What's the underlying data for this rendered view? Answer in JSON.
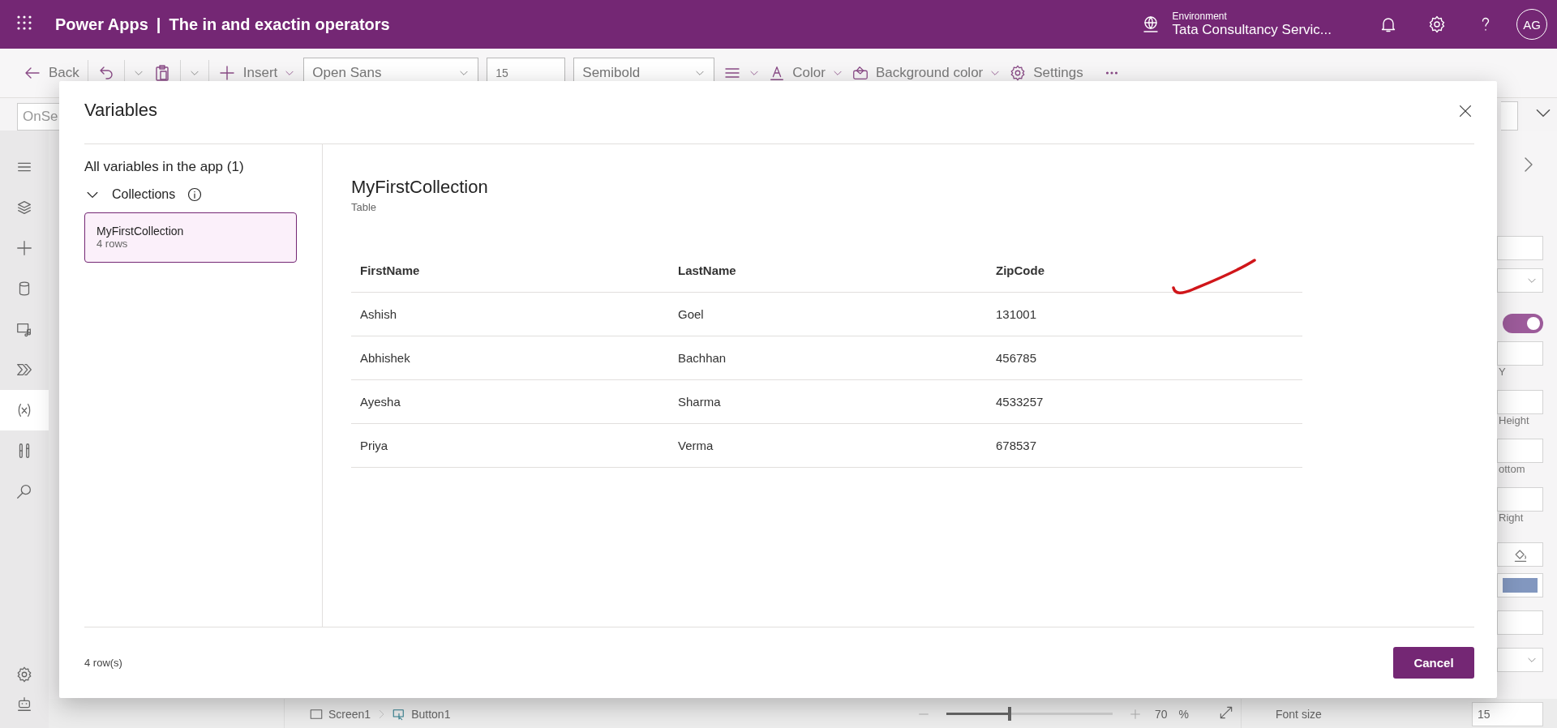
{
  "header": {
    "app_name": "Power Apps",
    "separator": "|",
    "document_title": "The in and exactin operators",
    "environment_label": "Environment",
    "environment_name": "Tata Consultancy Servic...",
    "avatar_initials": "AG"
  },
  "toolbar": {
    "back_label": "Back",
    "insert_label": "Insert",
    "font_name": "Open Sans",
    "font_size": "15",
    "font_weight": "Semibold",
    "color_label": "Color",
    "background_color_label": "Background color",
    "settings_label": "Settings"
  },
  "formula_bar": {
    "property": "OnSe"
  },
  "left_rail": {
    "items": [
      {
        "kind": "menu",
        "selected": false
      },
      {
        "kind": "layers",
        "selected": false
      },
      {
        "kind": "insert",
        "selected": false
      },
      {
        "kind": "data",
        "selected": false
      },
      {
        "kind": "media",
        "selected": false
      },
      {
        "kind": "flows",
        "selected": false
      },
      {
        "kind": "variables",
        "selected": true
      },
      {
        "kind": "tools",
        "selected": false
      },
      {
        "kind": "search",
        "selected": false
      }
    ]
  },
  "right_panel": {
    "toggle_on": true,
    "labels": [
      "Y",
      "Height",
      "ottom",
      "Right"
    ],
    "font_size_label": "Font size",
    "font_size_value": "15"
  },
  "canvas_footer": {
    "screen": "Screen1",
    "control": "Button1",
    "zoom": {
      "level": 0.37
    },
    "zoom_value": "70",
    "zoom_unit": "%"
  },
  "dialog": {
    "title": "Variables",
    "sidebar_heading": "All variables in the app (1)",
    "group": {
      "label": "Collections",
      "expanded": true
    },
    "collections": [
      {
        "name": "MyFirstCollection",
        "rows": "4 rows",
        "selected": true
      }
    ],
    "detail": {
      "name": "MyFirstCollection",
      "type": "Table"
    },
    "table": {
      "columns": [
        "FirstName",
        "LastName",
        "ZipCode"
      ],
      "rows": [
        [
          "Ashish",
          "Goel",
          "131001"
        ],
        [
          "Abhishek",
          "Bachhan",
          "456785"
        ],
        [
          "Ayesha",
          "Sharma",
          "4533257"
        ],
        [
          "Priya",
          "Verma",
          "678537"
        ]
      ]
    },
    "footer_count": "4 row(s)",
    "cancel_label": "Cancel"
  }
}
